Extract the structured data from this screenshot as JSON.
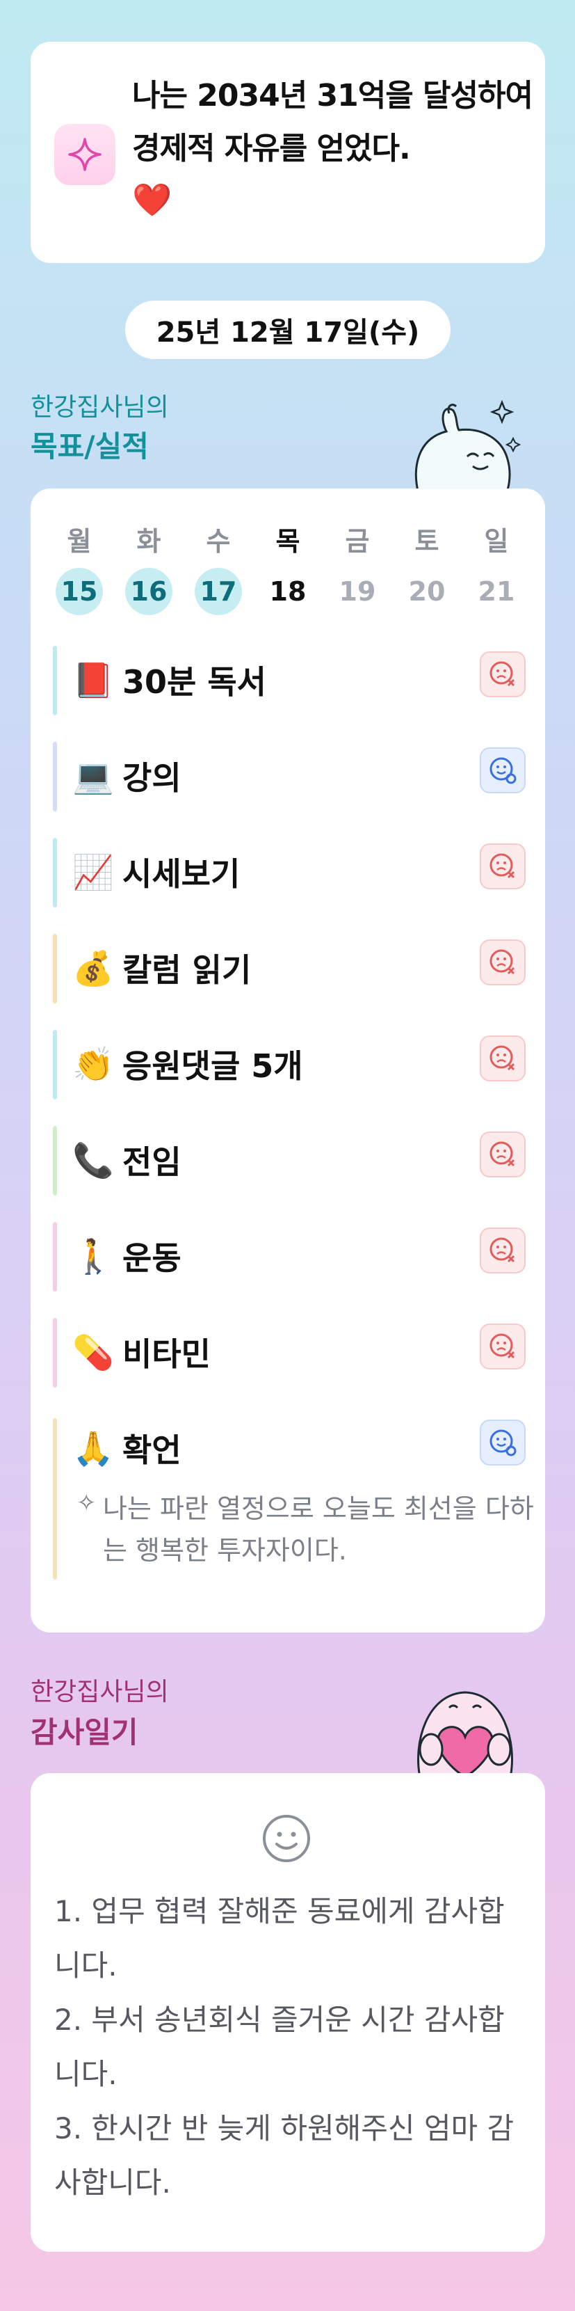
{
  "goal_banner": {
    "icon": "sparkle-icon",
    "text": "나는 2034년 31억을 달성하여 경제적 자유를 얻었다.",
    "heart": "❤️"
  },
  "date": "25년 12월 17일(수)",
  "goals_section": {
    "owner": "한강집사님의",
    "title": "목표/실적"
  },
  "week": [
    {
      "label": "월",
      "num": "15",
      "state": "done"
    },
    {
      "label": "화",
      "num": "16",
      "state": "done"
    },
    {
      "label": "수",
      "num": "17",
      "state": "done"
    },
    {
      "label": "목",
      "num": "18",
      "state": "today"
    },
    {
      "label": "금",
      "num": "19",
      "state": "future"
    },
    {
      "label": "토",
      "num": "20",
      "state": "future"
    },
    {
      "label": "일",
      "num": "21",
      "state": "future"
    }
  ],
  "tasks": [
    {
      "emoji": "📕",
      "label": "30분 독서",
      "status": "fail",
      "bar_color": "#bfeaf1"
    },
    {
      "emoji": "💻",
      "label": "강의",
      "status": "ok",
      "bar_color": "#d3dcf6"
    },
    {
      "emoji": "📈",
      "label": "시세보기",
      "status": "fail",
      "bar_color": "#bfeaf1"
    },
    {
      "emoji": "💰",
      "label": "칼럼 읽기",
      "status": "fail",
      "bar_color": "#f8dfb4"
    },
    {
      "emoji": "👏",
      "label": "응원댓글 5개",
      "status": "fail",
      "bar_color": "#bfeaf1"
    },
    {
      "emoji": "📞",
      "label": "전임",
      "status": "fail",
      "bar_color": "#cdeec6"
    },
    {
      "emoji": "🚶",
      "label": "운동",
      "status": "fail",
      "bar_color": "#f4cde6"
    },
    {
      "emoji": "💊",
      "label": "비타민",
      "status": "fail",
      "bar_color": "#f4cde6"
    },
    {
      "emoji": "🙏",
      "label": "확언",
      "status": "ok",
      "bar_color": "#f6e2b8"
    }
  ],
  "affirmation": "나는 파란 열정으로 오늘도 최선을 다하는 행복한 투자자이다.",
  "gratitude_section": {
    "owner": "한강집사님의",
    "title": "감사일기"
  },
  "gratitude_lines": [
    "1. 업무 협력 잘해준 동료에게 감사합니다.",
    "2. 부서 송년회식 즐거운 시간 감사합니다.",
    "3. 한시간 반 늦게 하원해주신 엄마 감사합니다."
  ],
  "colors": {
    "teal": "#14909a",
    "plum": "#a03272",
    "fail": "#e25c5c",
    "ok": "#3a6fe0"
  }
}
